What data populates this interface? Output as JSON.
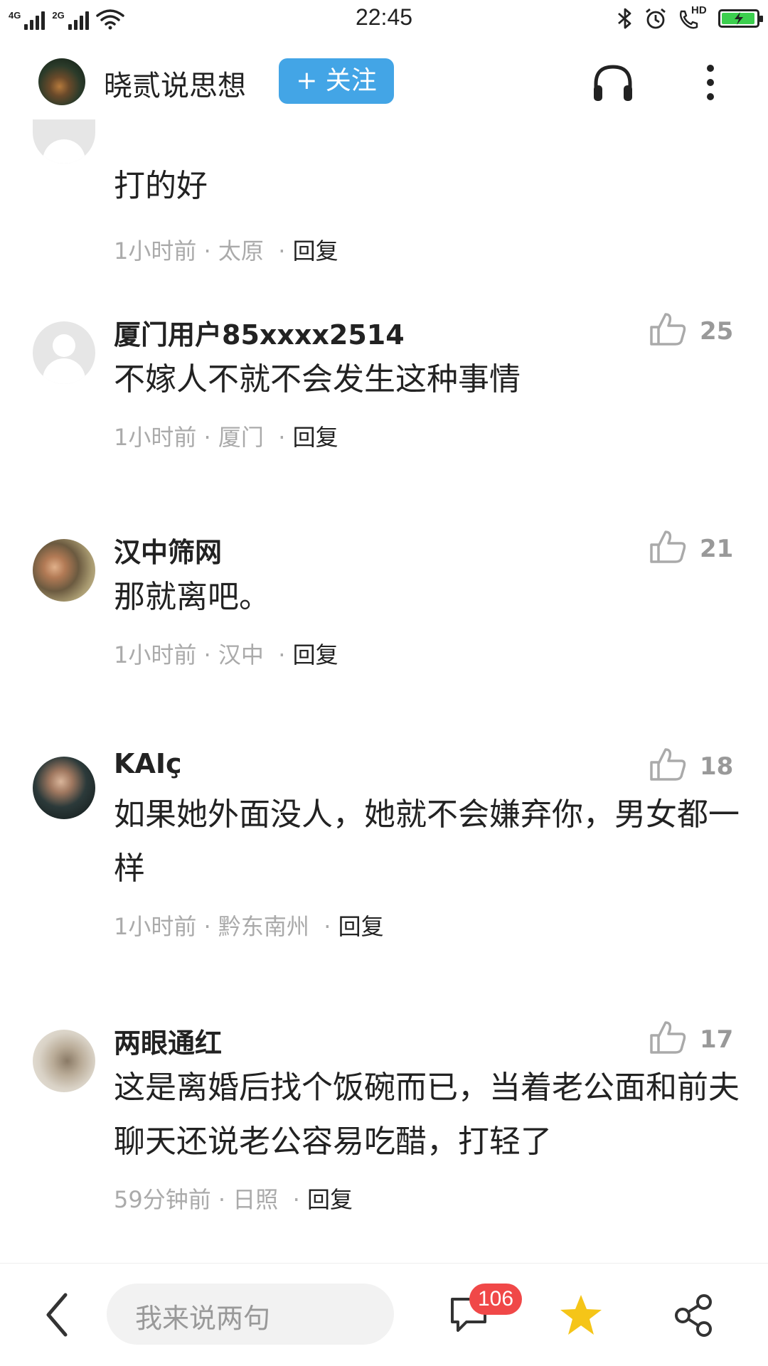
{
  "status_bar": {
    "network1": "4G",
    "network2": "2G",
    "time": "22:45",
    "hd_label": "HD",
    "battery_level": 0.95
  },
  "header": {
    "title": "晓贰说思想",
    "follow_label": "+ 关注"
  },
  "comments": [
    {
      "name": "",
      "text": "打的好",
      "time": "1小时前",
      "location": "太原",
      "reply": "回复",
      "likes": ""
    },
    {
      "name": "厦门用户85xxxx2514",
      "text": "不嫁人不就不会发生这种事情",
      "time": "1小时前",
      "location": "厦门",
      "reply": "回复",
      "likes": "25"
    },
    {
      "name": "汉中筛网",
      "text": "那就离吧。",
      "time": "1小时前",
      "location": "汉中",
      "reply": "回复",
      "likes": "21"
    },
    {
      "name": "KAIç",
      "text": "如果她外面没人，她就不会嫌弃你，男女都一样",
      "time": "1小时前",
      "location": "黔东南州",
      "reply": "回复",
      "likes": "18"
    },
    {
      "name": "两眼通红",
      "text": "这是离婚后找个饭碗而已，当着老公面和前夫聊天还说老公容易吃醋，打轻了",
      "time": "59分钟前",
      "location": "日照",
      "reply": "回复",
      "likes": "17"
    }
  ],
  "bottom_bar": {
    "input_placeholder": "我来说两句",
    "comment_count": "106"
  },
  "colors": {
    "accent": "#43a5e6",
    "badge": "#f04848",
    "star": "#f5c518"
  }
}
